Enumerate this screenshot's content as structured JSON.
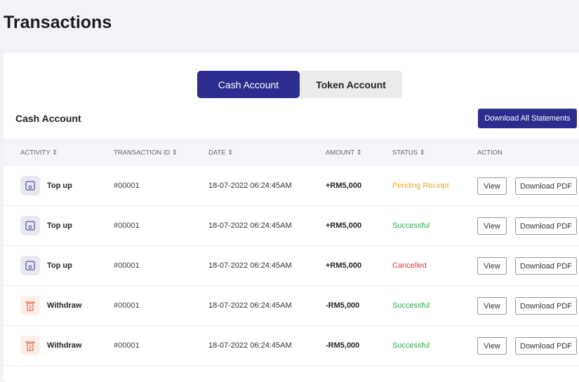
{
  "page": {
    "title": "Transactions"
  },
  "tabs": [
    {
      "label": "Cash Account",
      "active": true
    },
    {
      "label": "Token Account",
      "active": false
    }
  ],
  "section": {
    "title": "Cash Account",
    "download_all": "Download All Statements"
  },
  "table": {
    "headers": [
      "ACTIVITY ⇕",
      "TRANSACTION ID ⇕",
      "DATE ⇕",
      "AMOUNT ⇕",
      "STATUS ⇕",
      "ACTION"
    ],
    "rows": [
      {
        "icon": "top-up-icon",
        "activity": "Top up",
        "id": "#00001",
        "date": "18-07-2022 06:24:45AM",
        "amount": "+RM5,000",
        "status": "Pending Receipt",
        "status_color": "#f2a81d",
        "view": "View",
        "pdf": "Download PDF"
      },
      {
        "icon": "top-up-icon",
        "activity": "Top up",
        "id": "#00001",
        "date": "18-07-2022 06:24:45AM",
        "amount": "+RM5,000",
        "status": "Successful",
        "status_color": "#2fa84f",
        "view": "View",
        "pdf": "Download PDF"
      },
      {
        "icon": "top-up-icon",
        "activity": "Top up",
        "id": "#00001",
        "date": "18-07-2022 06:24:45AM",
        "amount": "+RM5,000",
        "status": "Cancelled",
        "status_color": "#e5393b",
        "view": "View",
        "pdf": "Download PDF"
      },
      {
        "icon": "withdraw-icon",
        "activity": "Withdraw",
        "id": "#00001",
        "date": "18-07-2022 06:24:45AM",
        "amount": "-RM5,000",
        "status": "Successful",
        "status_color": "#2fa84f",
        "view": "View",
        "pdf": "Download PDF"
      },
      {
        "icon": "withdraw-icon",
        "activity": "Withdraw",
        "id": "#00001",
        "date": "18-07-2022 06:24:45AM",
        "amount": "-RM5,000",
        "status": "Successful",
        "status_color": "#2fa84f",
        "view": "View",
        "pdf": "Download PDF"
      }
    ]
  }
}
